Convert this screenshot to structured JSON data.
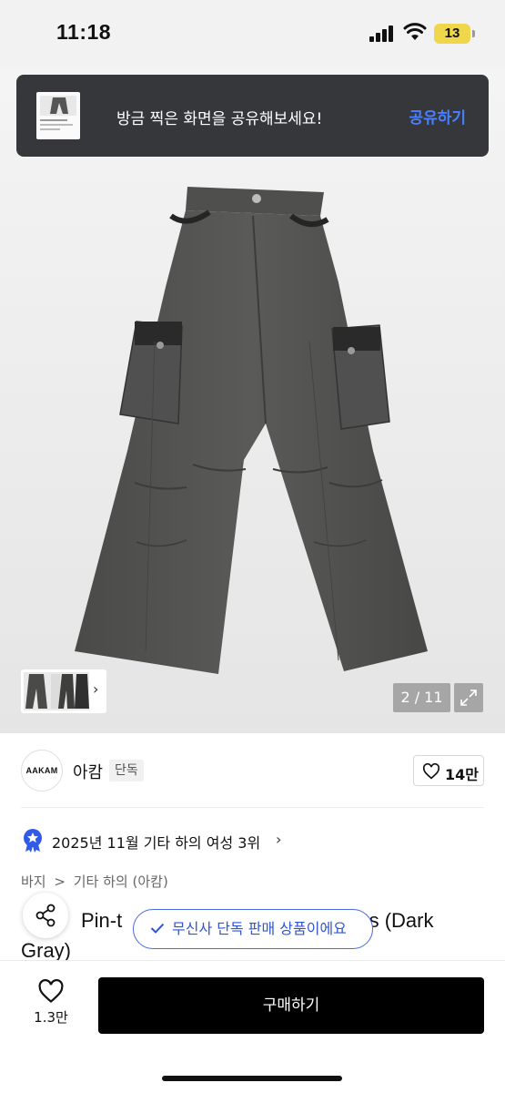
{
  "status_bar": {
    "time": "11:18",
    "battery": "13"
  },
  "toast": {
    "message": "방금 찍은 화면을 공유해보세요!",
    "action": "공유하기"
  },
  "gallery": {
    "pager": "2 / 11"
  },
  "brand": {
    "logo_text": "AAKAM",
    "name": "아캄",
    "badge": "단독",
    "likes": "14만"
  },
  "ranking": {
    "text": "2025년 11월 기타 하의 여성 3위"
  },
  "breadcrumb": {
    "items": [
      "바지",
      ">",
      "기타 하의 (아캄)"
    ]
  },
  "product": {
    "title_visible_left": "Pin-t",
    "title_visible_right": "nts (Dark",
    "title_line2": "Gray)"
  },
  "exclusive_pill": {
    "label": "무신사 단독 판매 상품이에요"
  },
  "bottom_bar": {
    "wish_count": "1.3만",
    "buy_label": "구매하기"
  },
  "colors": {
    "accent_blue": "#3f6bf0",
    "buy_button": "#000000",
    "toast_bg": "#35373b",
    "battery": "#f0d64a"
  }
}
